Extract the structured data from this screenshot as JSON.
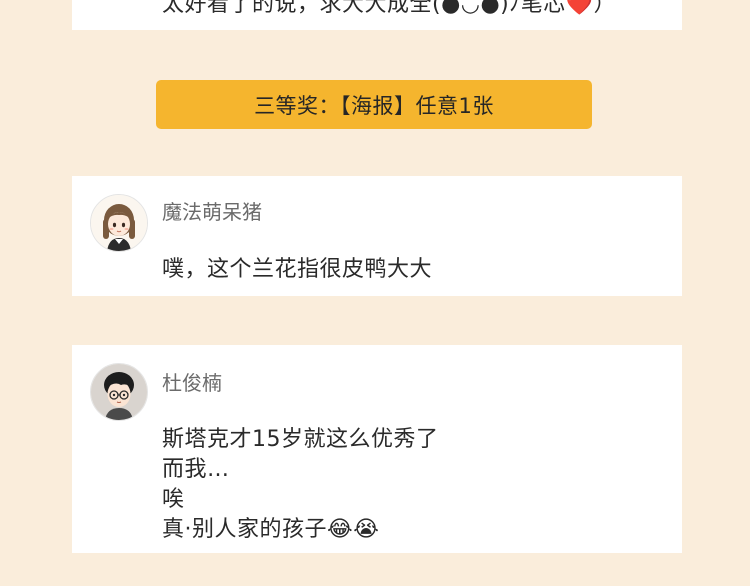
{
  "colors": {
    "page_background": "#faeddb",
    "card_background": "#ffffff",
    "banner_background": "#f5b52e",
    "username_color": "#6b6b6b",
    "text_color": "#2a2a2a"
  },
  "top_comment": {
    "text": "太好看了的说，求大大成全(●◡●)ﾉ笔芯❤️）"
  },
  "prize": {
    "label": "三等奖：【海报】任意1张"
  },
  "comments": [
    {
      "avatar_icon": "girl-avatar-icon",
      "username": "魔法萌呆猪",
      "lines": [
        "噗，这个兰花指很皮鸭大大"
      ]
    },
    {
      "avatar_icon": "boy-with-glasses-avatar-icon",
      "username": "杜俊楠",
      "lines": [
        "斯塔克才15岁就这么优秀了",
        "而我…",
        "唉",
        "真·别人家的孩子😂😭"
      ]
    }
  ]
}
